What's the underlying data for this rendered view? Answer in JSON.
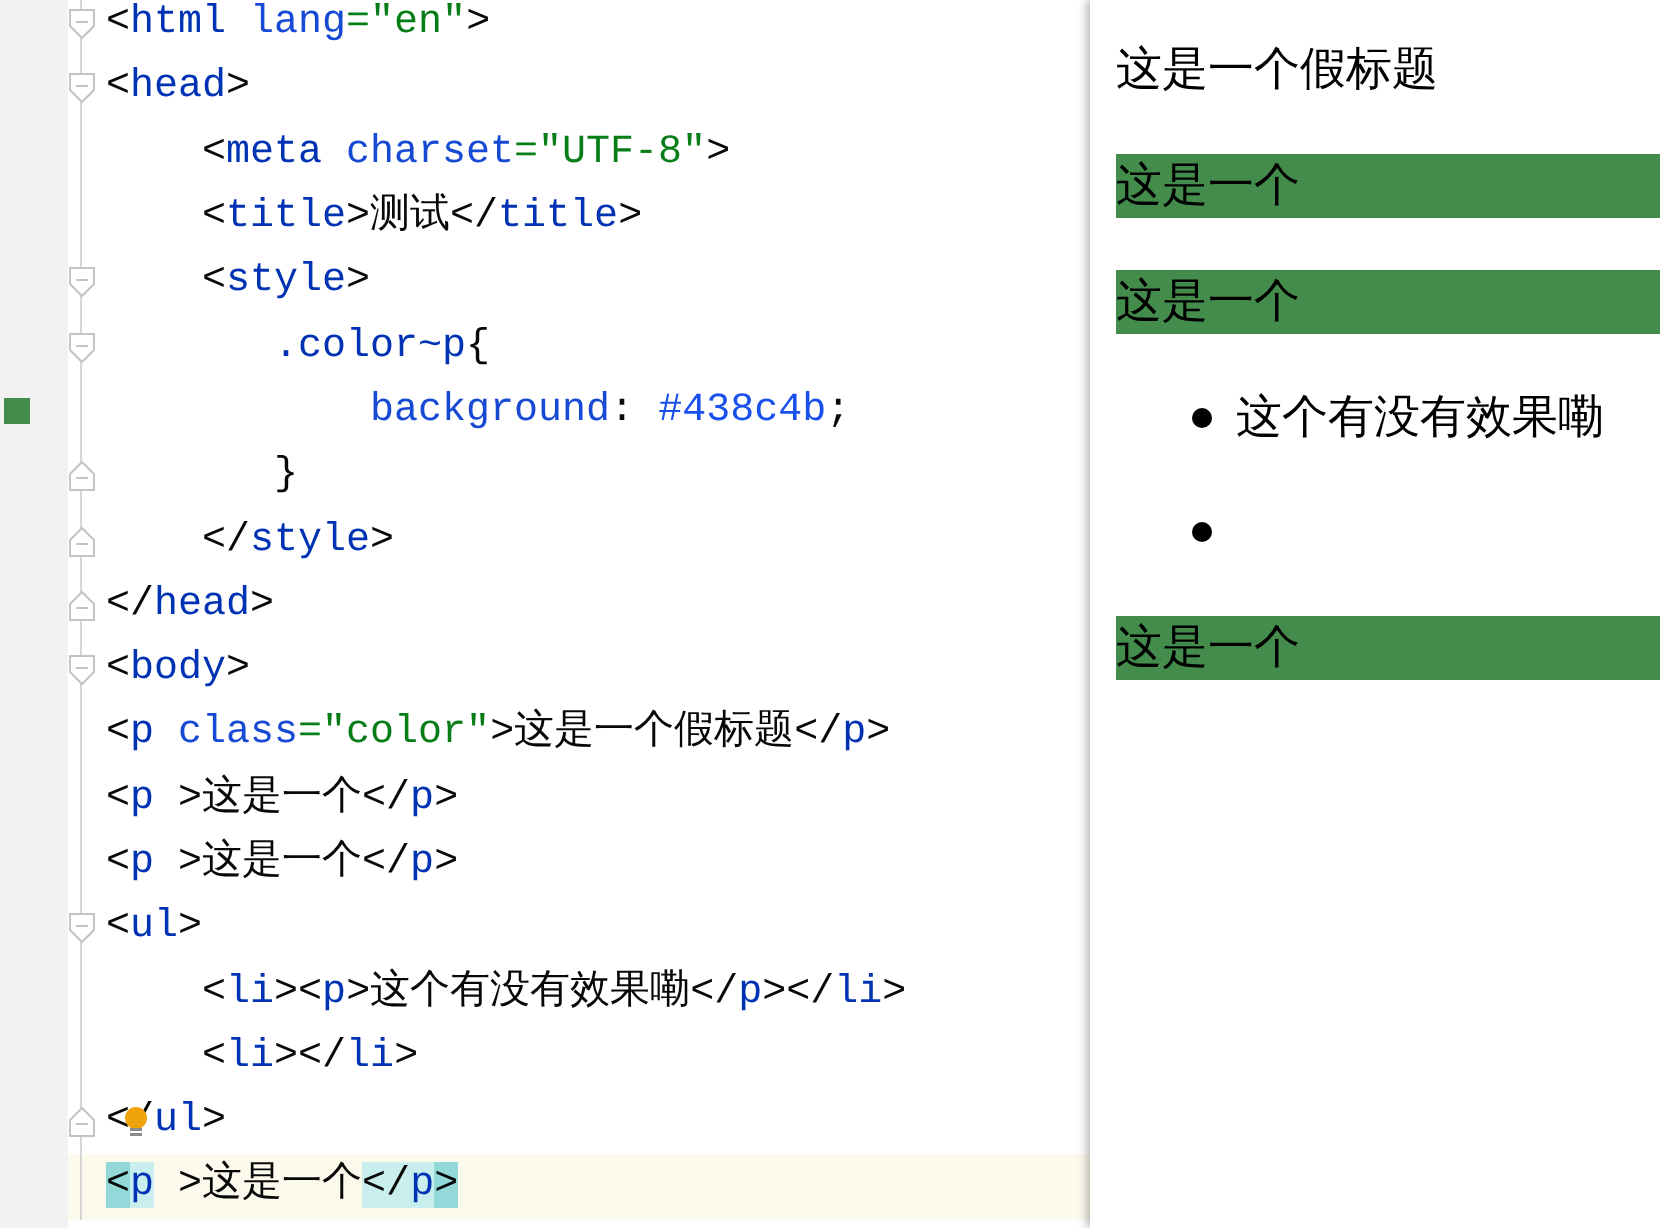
{
  "editor": {
    "lines": [
      {
        "fold_start": true,
        "tokens": [
          {
            "t": "<",
            "kind": "punct"
          },
          {
            "t": "html",
            "kind": "tag"
          },
          {
            "t": " lang",
            "kind": "attr"
          },
          {
            "t": "=\"en\"",
            "kind": "str"
          },
          {
            "t": ">",
            "kind": "punct"
          }
        ]
      },
      {
        "fold_start": true,
        "tokens": [
          {
            "t": "<",
            "kind": "punct"
          },
          {
            "t": "head",
            "kind": "tag"
          },
          {
            "t": ">",
            "kind": "punct"
          }
        ]
      },
      {
        "tokens": [
          {
            "t": "    <",
            "kind": "punct"
          },
          {
            "t": "meta",
            "kind": "tag"
          },
          {
            "t": " charset",
            "kind": "attr"
          },
          {
            "t": "=\"UTF-8\"",
            "kind": "str"
          },
          {
            "t": ">",
            "kind": "punct"
          }
        ]
      },
      {
        "tokens": [
          {
            "t": "    <",
            "kind": "punct"
          },
          {
            "t": "title",
            "kind": "tag"
          },
          {
            "t": ">测试</",
            "kind": "punct"
          },
          {
            "t": "title",
            "kind": "tag"
          },
          {
            "t": ">",
            "kind": "punct"
          }
        ]
      },
      {
        "fold_start": true,
        "tokens": [
          {
            "t": "    <",
            "kind": "punct"
          },
          {
            "t": "style",
            "kind": "tag"
          },
          {
            "t": ">",
            "kind": "punct"
          }
        ]
      },
      {
        "fold_start": true,
        "tokens": [
          {
            "t": "       .color~p",
            "kind": "sel"
          },
          {
            "t": "{",
            "kind": "punct"
          }
        ]
      },
      {
        "swatch": true,
        "tokens": [
          {
            "t": "           background",
            "kind": "prop"
          },
          {
            "t": ": ",
            "kind": "punct"
          },
          {
            "t": "#438c4b",
            "kind": "val"
          },
          {
            "t": ";",
            "kind": "punct"
          }
        ]
      },
      {
        "fold_end": true,
        "tokens": [
          {
            "t": "       }",
            "kind": "punct"
          }
        ]
      },
      {
        "fold_end": true,
        "tokens": [
          {
            "t": "    </",
            "kind": "punct"
          },
          {
            "t": "style",
            "kind": "tag"
          },
          {
            "t": ">",
            "kind": "punct"
          }
        ]
      },
      {
        "fold_end": true,
        "tokens": [
          {
            "t": "</",
            "kind": "punct"
          },
          {
            "t": "head",
            "kind": "tag"
          },
          {
            "t": ">",
            "kind": "punct"
          }
        ]
      },
      {
        "fold_start": true,
        "tokens": [
          {
            "t": "<",
            "kind": "punct"
          },
          {
            "t": "body",
            "kind": "tag"
          },
          {
            "t": ">",
            "kind": "punct"
          }
        ]
      },
      {
        "tokens": [
          {
            "t": "<",
            "kind": "punct"
          },
          {
            "t": "p",
            "kind": "tag"
          },
          {
            "t": " class",
            "kind": "attr"
          },
          {
            "t": "=\"color\"",
            "kind": "str"
          },
          {
            "t": ">这是一个假标题</",
            "kind": "punct"
          },
          {
            "t": "p",
            "kind": "tag"
          },
          {
            "t": ">",
            "kind": "punct"
          }
        ]
      },
      {
        "tokens": [
          {
            "t": "<",
            "kind": "punct"
          },
          {
            "t": "p",
            "kind": "tag"
          },
          {
            "t": " >这是一个</",
            "kind": "punct"
          },
          {
            "t": "p",
            "kind": "tag"
          },
          {
            "t": ">",
            "kind": "punct"
          }
        ]
      },
      {
        "tokens": [
          {
            "t": "<",
            "kind": "punct"
          },
          {
            "t": "p",
            "kind": "tag"
          },
          {
            "t": " >这是一个</",
            "kind": "punct"
          },
          {
            "t": "p",
            "kind": "tag"
          },
          {
            "t": ">",
            "kind": "punct"
          }
        ]
      },
      {
        "fold_start": true,
        "tokens": [
          {
            "t": "<",
            "kind": "punct"
          },
          {
            "t": "ul",
            "kind": "tag"
          },
          {
            "t": ">",
            "kind": "punct"
          }
        ]
      },
      {
        "tokens": [
          {
            "t": "    <",
            "kind": "punct"
          },
          {
            "t": "li",
            "kind": "tag"
          },
          {
            "t": "><",
            "kind": "punct"
          },
          {
            "t": "p",
            "kind": "tag"
          },
          {
            "t": ">这个有没有效果嘞</",
            "kind": "punct"
          },
          {
            "t": "p",
            "kind": "tag"
          },
          {
            "t": "></",
            "kind": "punct"
          },
          {
            "t": "li",
            "kind": "tag"
          },
          {
            "t": ">",
            "kind": "punct"
          }
        ]
      },
      {
        "tokens": [
          {
            "t": "    <",
            "kind": "punct"
          },
          {
            "t": "li",
            "kind": "tag"
          },
          {
            "t": "></",
            "kind": "punct"
          },
          {
            "t": "li",
            "kind": "tag"
          },
          {
            "t": ">",
            "kind": "punct"
          }
        ]
      },
      {
        "fold_end": true,
        "bulb": true,
        "tokens": [
          {
            "t": "</",
            "kind": "punct"
          },
          {
            "t": "ul",
            "kind": "tag"
          },
          {
            "t": ">",
            "kind": "punct"
          }
        ]
      },
      {
        "current": true,
        "tokens": [
          {
            "t": "<",
            "kind": "punct",
            "strong_match": true
          },
          {
            "t": "p",
            "kind": "tag",
            "soft_match": true
          },
          {
            "t": " >这是一个",
            "kind": "punct"
          },
          {
            "t": "</",
            "kind": "punct",
            "soft_match": true
          },
          {
            "t": "p",
            "kind": "tag",
            "soft_match": true
          },
          {
            "t": ">",
            "kind": "punct",
            "strong_match": true
          }
        ]
      }
    ]
  },
  "preview": {
    "blocks": [
      {
        "kind": "paragraph",
        "text": "这是一个假标题",
        "highlighted": false
      },
      {
        "kind": "paragraph",
        "text": "这是一个",
        "highlighted": true
      },
      {
        "kind": "paragraph",
        "text": "这是一个",
        "highlighted": true
      },
      {
        "kind": "list",
        "items": [
          {
            "kind": "text",
            "text": "这个有没有效果嘞"
          },
          {
            "kind": "empty"
          }
        ]
      },
      {
        "kind": "paragraph",
        "text": "这是一个",
        "highlighted": true
      }
    ]
  }
}
